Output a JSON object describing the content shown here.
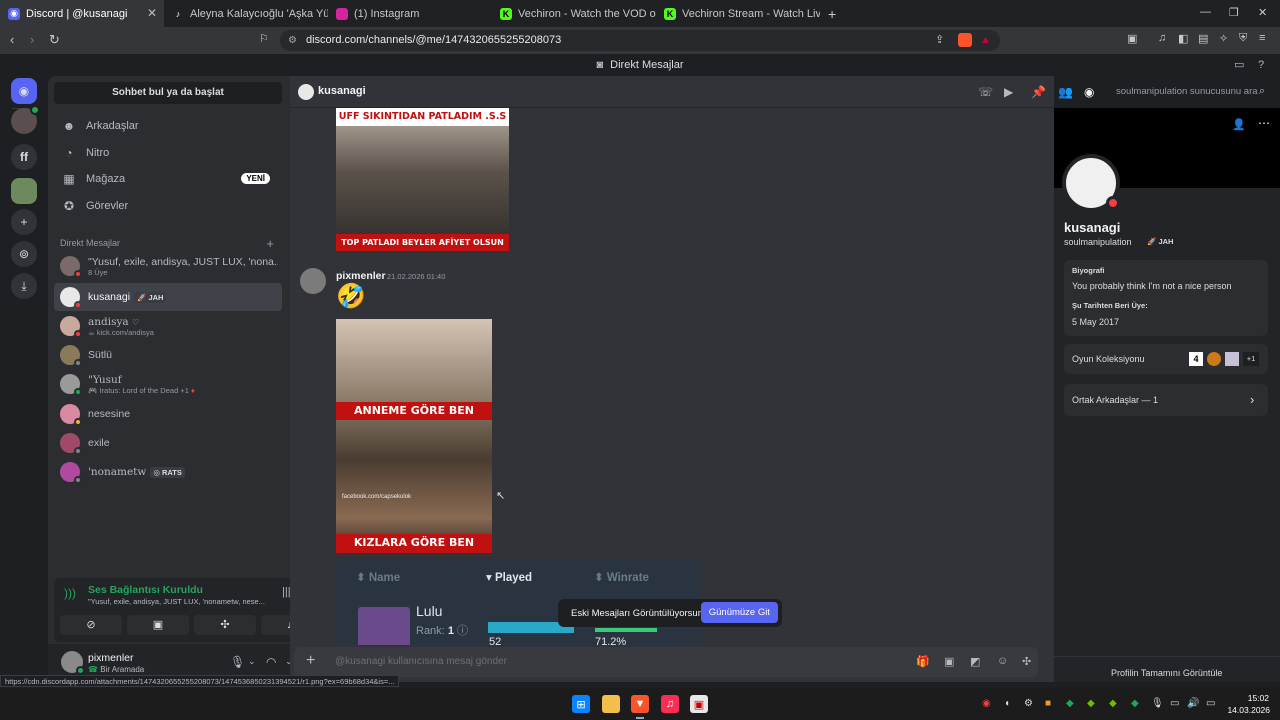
{
  "browser": {
    "tabs": [
      {
        "label": "Discord | @kusanagi",
        "active": true
      },
      {
        "label": "Aleyna Kalaycıoğlu 'Aşka Yürek Gerek"
      },
      {
        "label": "(1) Instagram"
      },
      {
        "label": "Vechiron - Watch the VOD on Kick"
      },
      {
        "label": "Vechiron Stream - Watch Live on Kick"
      }
    ],
    "url": "discord.com/channels/@me/1474320655255208073",
    "status_url": "https://cdn.discordapp.com/attachments/1474320655255208073/1474536850231394521/r1.png?ex=69b68d34&is=..."
  },
  "app": {
    "title": "Direkt Mesajlar"
  },
  "sidebar": {
    "search_placeholder": "Sohbet bul ya da başlat",
    "nav": [
      {
        "label": "Arkadaşlar",
        "icon": "friends-icon"
      },
      {
        "label": "Nitro",
        "icon": "nitro-icon"
      },
      {
        "label": "Mağaza",
        "icon": "shop-icon",
        "badge": "YENİ"
      },
      {
        "label": "Görevler",
        "icon": "quests-icon"
      }
    ],
    "dm_header": "Direkt Mesajlar",
    "dms": [
      {
        "name": "\"Yusuf, exile, andisya, JUST LUX, 'nona...",
        "sub": "8 Üye"
      },
      {
        "name": "kusanagi",
        "tag": "JAH",
        "selected": true
      },
      {
        "name": "andisya",
        "sub": "kick.com/andisya"
      },
      {
        "name": "Sütlü"
      },
      {
        "name": "\"Yusuf",
        "sub": "Iratus: Lord of the Dead +1"
      },
      {
        "name": "nesesine"
      },
      {
        "name": "exile"
      },
      {
        "name": "'nonametw",
        "tag": "RATS"
      }
    ],
    "voice": {
      "status": "Ses Bağlantısı Kuruldu",
      "channel": "\"Yusuf, exile, andisya, JUST LUX, 'nonametw, nese..."
    },
    "user": {
      "name": "pixmenler",
      "status": "Bir Aramada"
    }
  },
  "chat": {
    "recipient": "kusanagi",
    "search_placeholder": "soulmanipulation sunucusunu ara",
    "meme1": {
      "top": "UFF SIKINTIDAN PATLADIM .S.S",
      "bottom": "TOP PATLADI BEYLER AFİYET OLSUN"
    },
    "message": {
      "author": "pixmenler",
      "timestamp": "21.02.2026 01:40",
      "emoji": "🤣"
    },
    "meme2": {
      "top": "ANNEME GÖRE BEN",
      "bottom": "KIZLARA GÖRE BEN",
      "watermark": "facebook.com/capsekulok"
    },
    "stats": {
      "cols": [
        "Name",
        "Played",
        "Winrate"
      ],
      "champ": "Lulu",
      "rank_label": "Rank:",
      "rank": "1",
      "played": "52",
      "winrate": "71.2%"
    },
    "toast": {
      "text": "Eski Mesajları Görüntülüyorsun",
      "button": "Günümüze Git"
    },
    "composer_placeholder": "@kusanagi kullanıcısına mesaj gönder"
  },
  "profile": {
    "name": "kusanagi",
    "username": "soulmanipulation",
    "tag": "JAH",
    "bio_label": "Biyografi",
    "bio": "You probably think I'm not a nice person",
    "since_label": "Şu Tarihten Beri Üye:",
    "since": "5 May 2017",
    "games_label": "Oyun Koleksiyonu",
    "games_more": "+1",
    "mutual": "Ortak Arkadaşlar — 1",
    "view_full": "Profilin Tamamını Görüntüle"
  },
  "taskbar": {
    "time": "15:02",
    "date": "14.03.2026"
  },
  "colors": {
    "blurple": "#5865f2",
    "green": "#23a55a",
    "dnd": "#f23f43"
  }
}
